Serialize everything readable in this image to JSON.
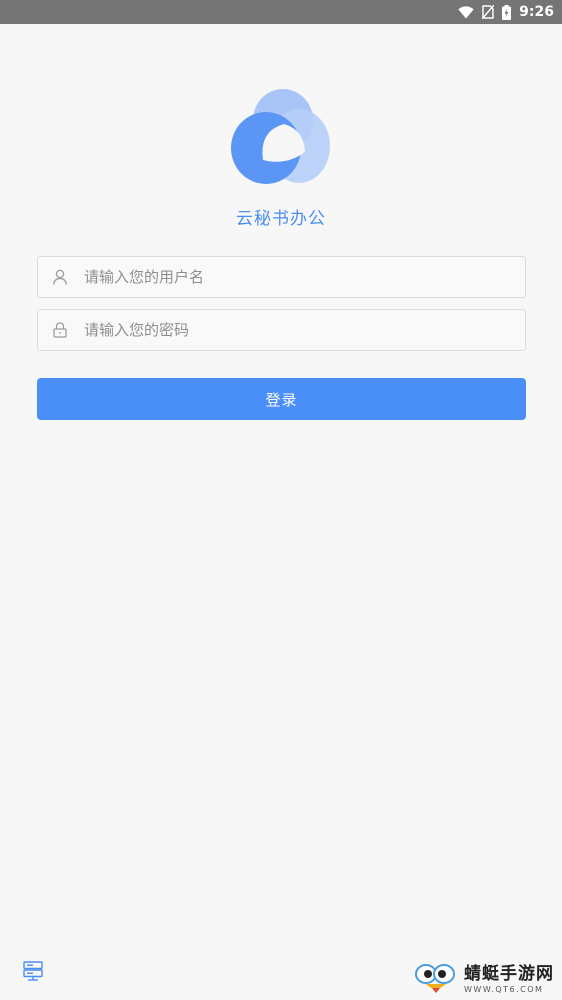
{
  "status_bar": {
    "time": "9:26",
    "icons": [
      "wifi-icon",
      "no-sim-icon",
      "battery-charging-icon"
    ]
  },
  "app": {
    "name": "云秘书办公",
    "logo_icon": "three-circle-logo-icon",
    "accent_color": "#4a8ef8"
  },
  "form": {
    "username": {
      "placeholder": "请输入您的用户名",
      "value": "",
      "icon": "user-icon"
    },
    "password": {
      "placeholder": "请输入您的密码",
      "value": "",
      "icon": "lock-icon"
    },
    "login_label": "登录"
  },
  "footer": {
    "server_icon": "server-settings-icon"
  },
  "watermark": {
    "title": "蜻蜓手游网",
    "url": "WWW.QT6.COM"
  }
}
